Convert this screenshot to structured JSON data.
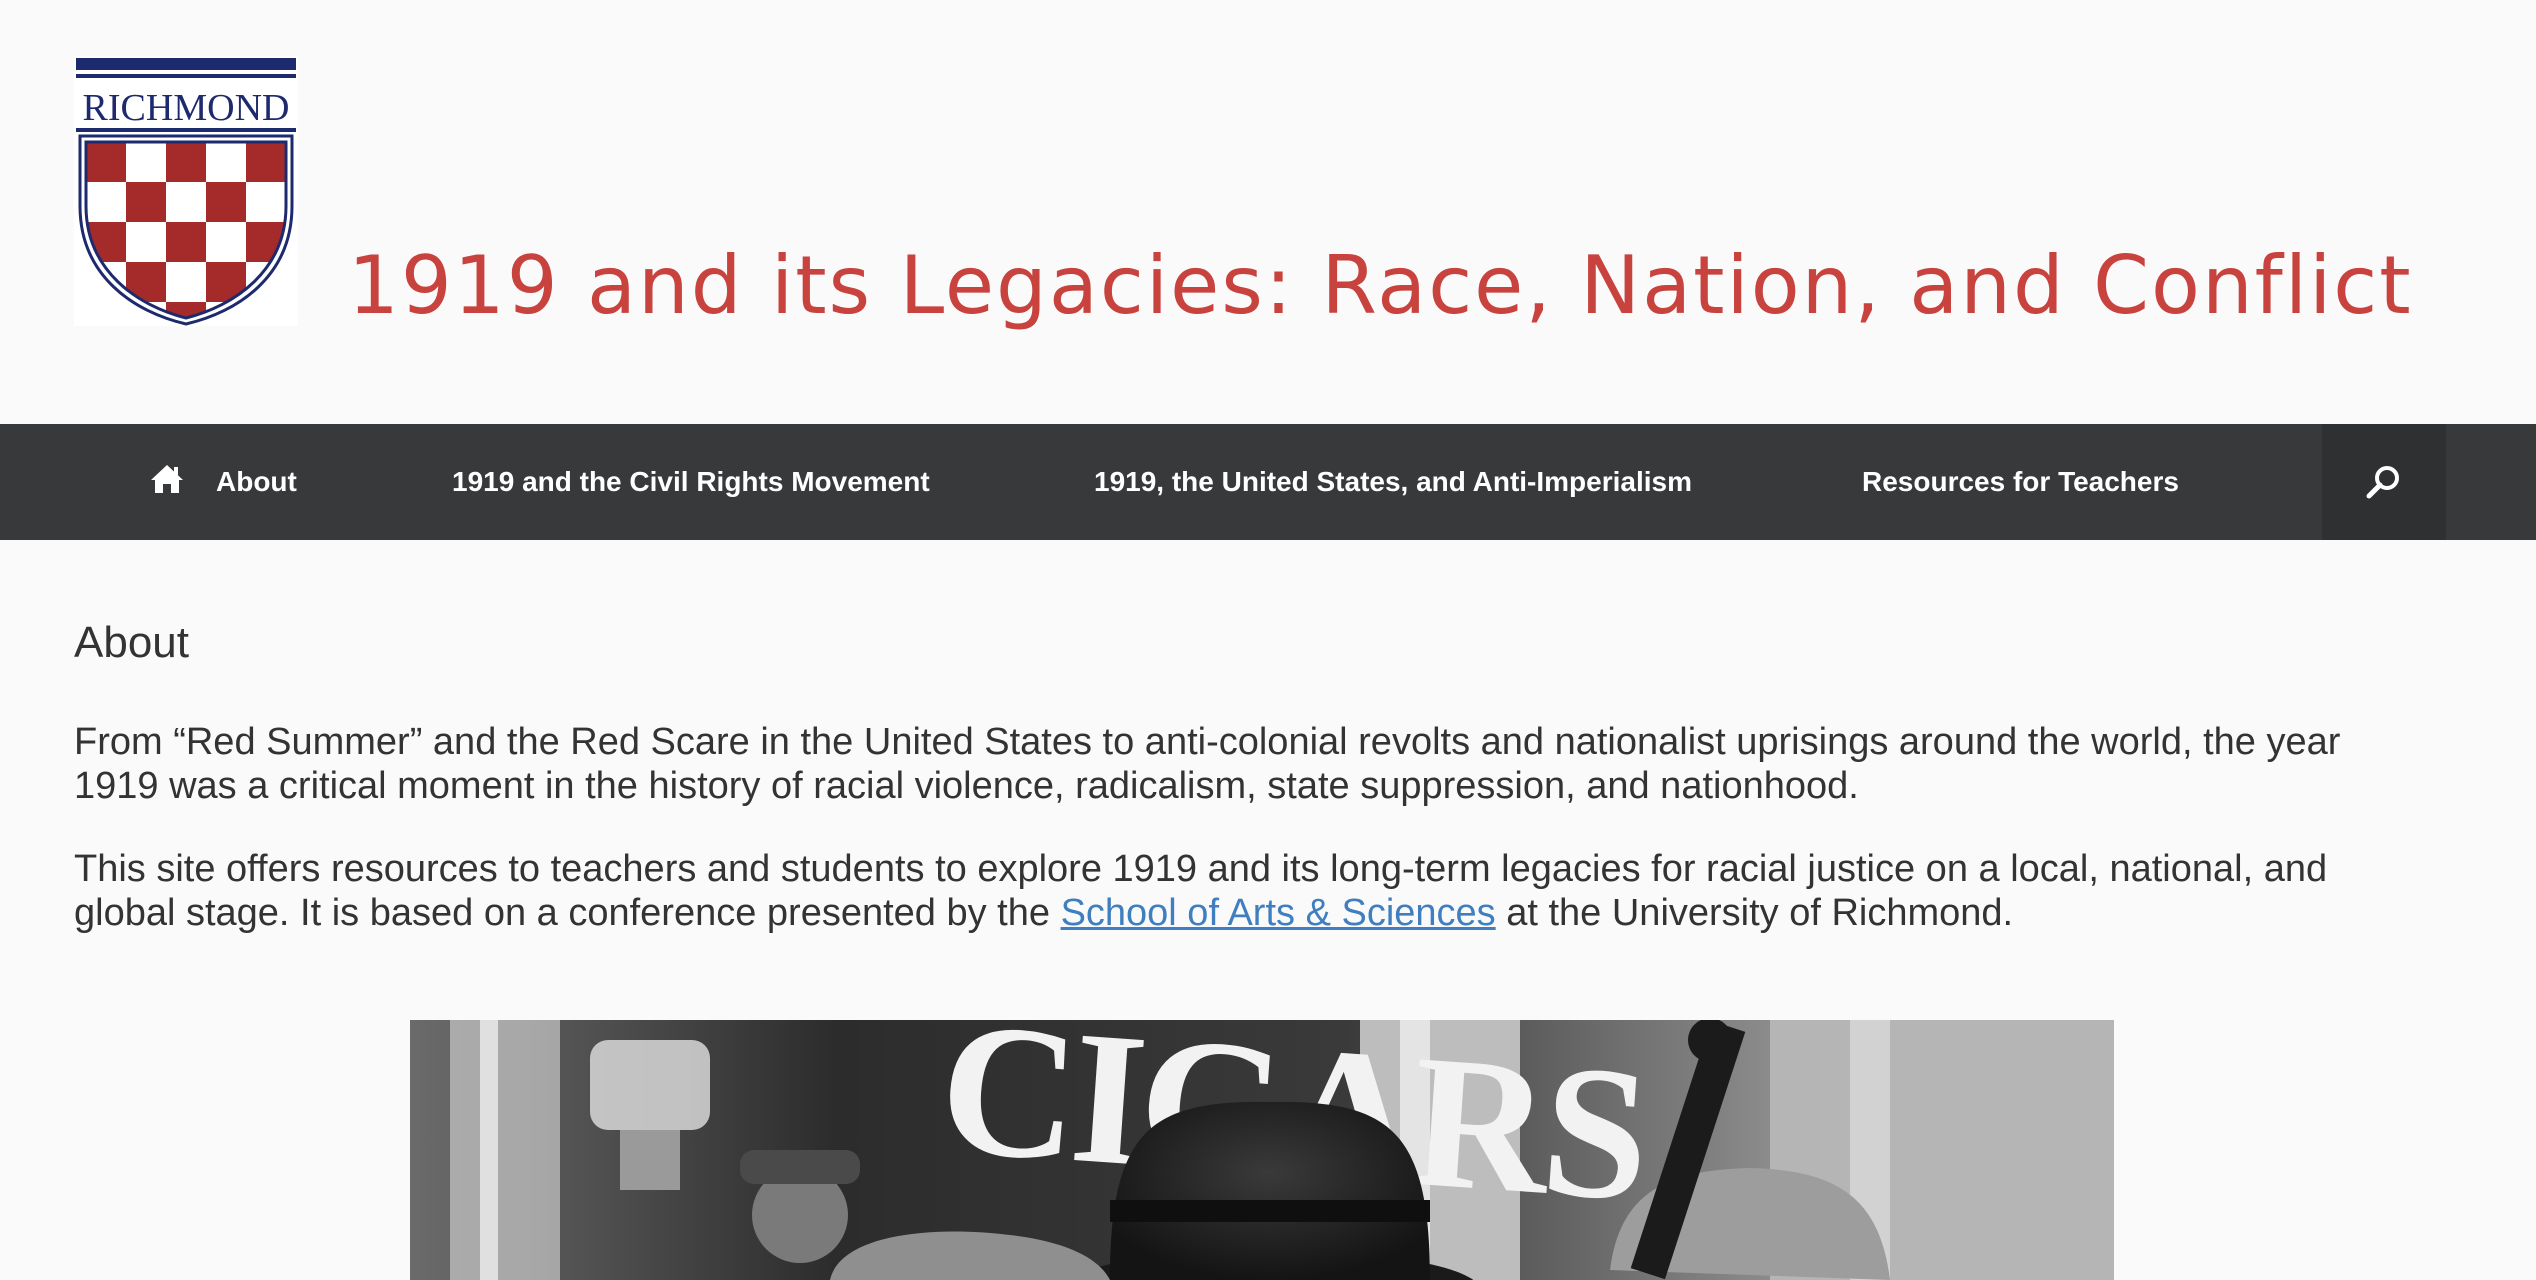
{
  "logo": {
    "text": "RICHMOND",
    "colors": {
      "navy": "#1e2a6e",
      "red": "#a52a2a"
    }
  },
  "site": {
    "title": "1919 and its Legacies: Race, Nation, and Conflict",
    "title_color": "#c8423e"
  },
  "nav": {
    "items": [
      {
        "label": "About",
        "icon": "home-icon"
      },
      {
        "label": "1919 and the Civil Rights Movement"
      },
      {
        "label": "1919, the United States, and Anti-Imperialism"
      },
      {
        "label": "Resources for Teachers"
      }
    ],
    "search_icon": "search-icon",
    "background": "#38393b"
  },
  "main": {
    "heading": "About",
    "paragraph1": "From “Red Summer” and the Red Scare in the United States to anti-colonial revolts and nationalist uprisings around the world, the year 1919 was a critical moment in the history of racial violence, radicalism, state suppression, and nationhood.",
    "paragraph2_before": "This site offers resources to teachers and students to explore 1919 and its long-term legacies for racial justice on a local, national, and global stage. It is based on a conference presented  by the ",
    "paragraph2_link": "School of Arts & Sciences",
    "paragraph2_after": " at the University of Richmond.",
    "link_color": "#3f7fc0",
    "photo_sign_text": "CIGARS"
  }
}
